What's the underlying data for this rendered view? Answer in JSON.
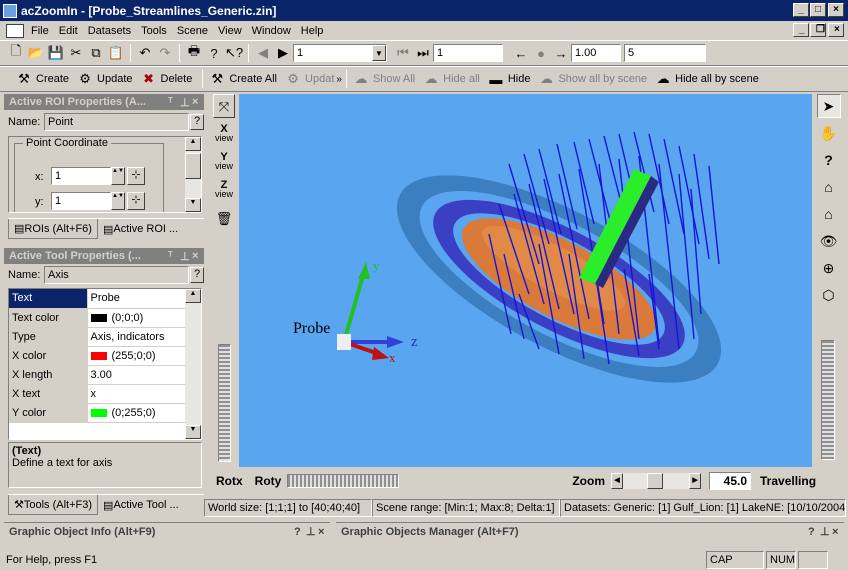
{
  "window": {
    "title": "acZoomIn - [Probe_Streamlines_Generic.zin]"
  },
  "menu": [
    "File",
    "Edit",
    "Datasets",
    "Tools",
    "Scene",
    "View",
    "Window",
    "Help"
  ],
  "toolbar1": {
    "frame_value": "1",
    "frame_field": "1",
    "speed_value": "1.00",
    "step_value": "5"
  },
  "toolbar2": {
    "create": "Create",
    "update": "Update",
    "delete": "Delete",
    "create_all": "Create All",
    "update_all": "Updat",
    "show_all": "Show All",
    "hide_all": "Hide all",
    "hide": "Hide",
    "show_all_by_scene": "Show all by scene",
    "hide_all_by_scene": "Hide all by scene"
  },
  "roi_panel": {
    "title": "Active ROI Properties (A...",
    "name_label": "Name:",
    "name_value": "Point",
    "group_label": "Point Coordinate",
    "x_label": "x:",
    "x_value": "1",
    "y_label": "y:",
    "y_value": "1",
    "tab1": "ROIs (Alt+F6)",
    "tab2": "Active ROI ..."
  },
  "tool_panel": {
    "title": "Active Tool Properties (...",
    "name_label": "Name:",
    "name_value": "Axis",
    "rows": [
      {
        "key": "Text",
        "value": "Probe"
      },
      {
        "key": "Text color",
        "value": "(0;0;0)",
        "swatch": "#000000"
      },
      {
        "key": "Type",
        "value": "Axis, indicators"
      },
      {
        "key": "X color",
        "value": "(255;0;0)",
        "swatch": "#ff0000"
      },
      {
        "key": "X length",
        "value": "3.00"
      },
      {
        "key": "X text",
        "value": "x"
      },
      {
        "key": "Y color",
        "value": "(0;255;0)",
        "swatch": "#00ff00"
      }
    ],
    "help_title": "(Text)",
    "help_text": "Define a text for axis",
    "tab1": "Tools (Alt+F3)",
    "tab2": "Active Tool ..."
  },
  "view_buttons": {
    "x": "X",
    "y": "Y",
    "z": "Z",
    "view": "view"
  },
  "viewport": {
    "probe_label": "Probe",
    "axis_x": "x",
    "axis_y": "y",
    "axis_z": "z",
    "background": "#5aa5ef"
  },
  "viewer_controls": {
    "rotx": "Rotx",
    "roty": "Roty",
    "zoom": "Zoom",
    "zoom_value": "45.0",
    "travelling": "Travelling"
  },
  "info_bar": {
    "world_size": "World size: [1;1;1] to [40;40;40]",
    "scene_range": "Scene range: [Min:1; Max:8; Delta:1]",
    "datasets": "Datasets: Generic: [1] Gulf_Lion: [1] LakeNE: [10/10/2004"
  },
  "bottom_panels": {
    "left": "Graphic Object Info (Alt+F9)",
    "right": "Graphic Objects Manager (Alt+F7)"
  },
  "statusbar": {
    "help": "For Help, press F1",
    "cap": "CAP",
    "num": "NUM"
  }
}
